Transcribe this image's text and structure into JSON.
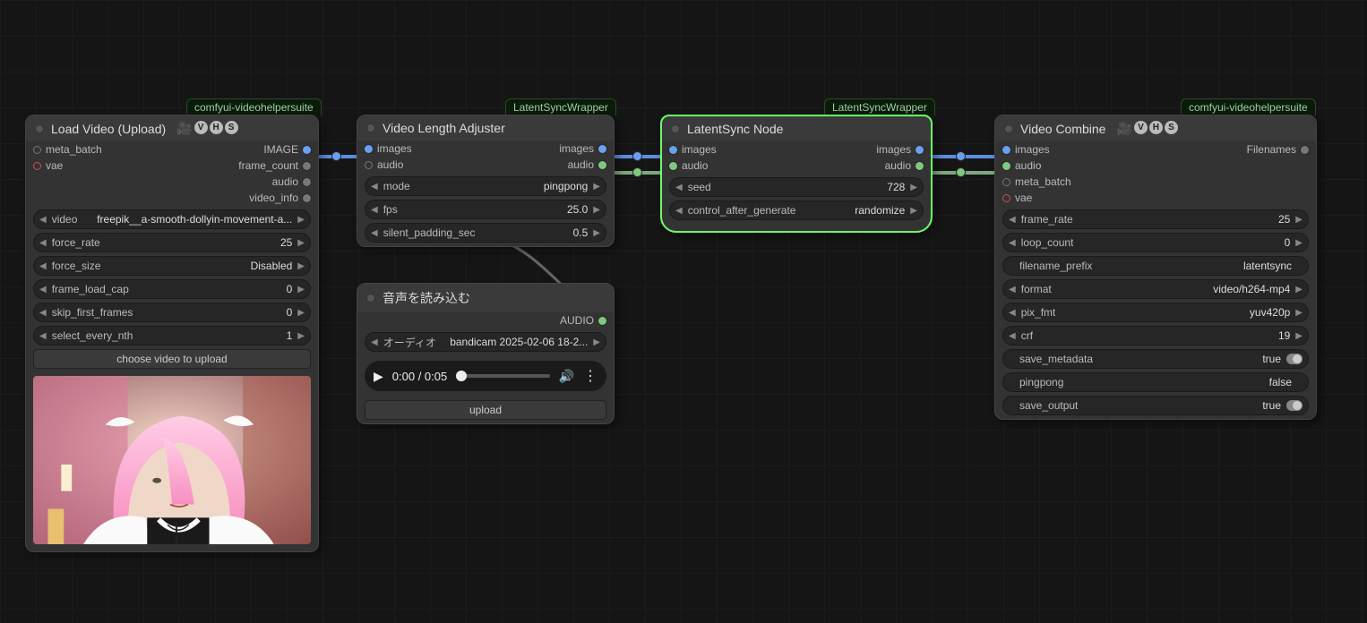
{
  "badges": {
    "load_video": "comfyui-videohelpersuite",
    "video_length": "LatentSyncWrapper",
    "latentsync": "LatentSyncWrapper",
    "video_combine": "comfyui-videohelpersuite"
  },
  "nodes": {
    "load_video": {
      "title": "Load Video (Upload)",
      "inputs": {
        "meta_batch": "meta_batch",
        "vae": "vae"
      },
      "outputs": {
        "image": "IMAGE",
        "frame_count": "frame_count",
        "audio": "audio",
        "video_info": "video_info"
      },
      "widgets": {
        "video_label": "video",
        "video_value": "freepik__a-smooth-dollyin-movement-a...",
        "force_rate_label": "force_rate",
        "force_rate": "25",
        "force_size_label": "force_size",
        "force_size": "Disabled",
        "frame_load_cap_label": "frame_load_cap",
        "frame_load_cap": "0",
        "skip_first_frames_label": "skip_first_frames",
        "skip_first_frames": "0",
        "select_every_nth_label": "select_every_nth",
        "select_every_nth": "1",
        "choose_btn": "choose video to upload"
      }
    },
    "video_length": {
      "title": "Video Length Adjuster",
      "inputs": {
        "images": "images",
        "audio": "audio"
      },
      "outputs": {
        "images": "images",
        "audio": "audio"
      },
      "widgets": {
        "mode_label": "mode",
        "mode": "pingpong",
        "fps_label": "fps",
        "fps": "25.0",
        "silent_padding_label": "silent_padding_sec",
        "silent_padding": "0.5"
      }
    },
    "load_audio": {
      "title": "音声を読み込む",
      "outputs": {
        "audio": "AUDIO"
      },
      "widgets": {
        "audio_label": "オーディオ",
        "audio_value": "bandicam 2025-02-06 18-2...",
        "time": "0:00 / 0:05",
        "upload_btn": "upload"
      }
    },
    "latentsync": {
      "title": "LatentSync Node",
      "inputs": {
        "images": "images",
        "audio": "audio"
      },
      "outputs": {
        "images": "images",
        "audio": "audio"
      },
      "widgets": {
        "seed_label": "seed",
        "seed": "728",
        "control_label": "control_after_generate",
        "control": "randomize"
      }
    },
    "video_combine": {
      "title": "Video Combine",
      "inputs": {
        "images": "images",
        "audio": "audio",
        "meta_batch": "meta_batch",
        "vae": "vae"
      },
      "outputs": {
        "filenames": "Filenames"
      },
      "widgets": {
        "frame_rate_label": "frame_rate",
        "frame_rate": "25",
        "loop_count_label": "loop_count",
        "loop_count": "0",
        "filename_prefix_label": "filename_prefix",
        "filename_prefix": "latentsync",
        "format_label": "format",
        "format": "video/h264-mp4",
        "pix_fmt_label": "pix_fmt",
        "pix_fmt": "yuv420p",
        "crf_label": "crf",
        "crf": "19",
        "save_metadata_label": "save_metadata",
        "save_metadata": "true",
        "pingpong_label": "pingpong",
        "pingpong": "false",
        "save_output_label": "save_output",
        "save_output": "true"
      }
    }
  }
}
